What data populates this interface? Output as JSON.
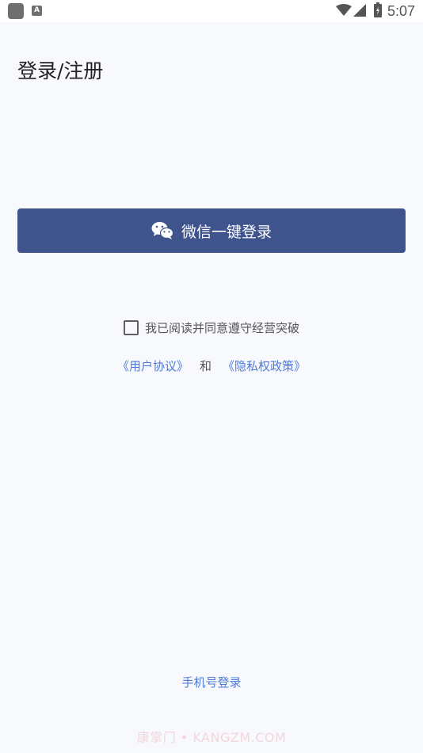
{
  "status_bar": {
    "a_label": "A",
    "time": "5:07",
    "icons": [
      "app-icon",
      "a-icon",
      "wifi-icon",
      "signal-icon",
      "battery-icon"
    ]
  },
  "page": {
    "title": "登录/注册"
  },
  "wechat_login": {
    "label": "微信一键登录",
    "icon": "wechat-icon",
    "color": "#3f548c"
  },
  "agreement": {
    "text": "我已阅读并同意遵守经营突破",
    "checked": false,
    "user_agreement": "《用户协议》",
    "and": "和",
    "privacy_policy": "《隐私权政策》",
    "link_color": "#4d7ad8"
  },
  "phone_login": {
    "label": "手机号登录"
  },
  "watermark": {
    "text": "康掌门 • KANGZM.COM"
  }
}
